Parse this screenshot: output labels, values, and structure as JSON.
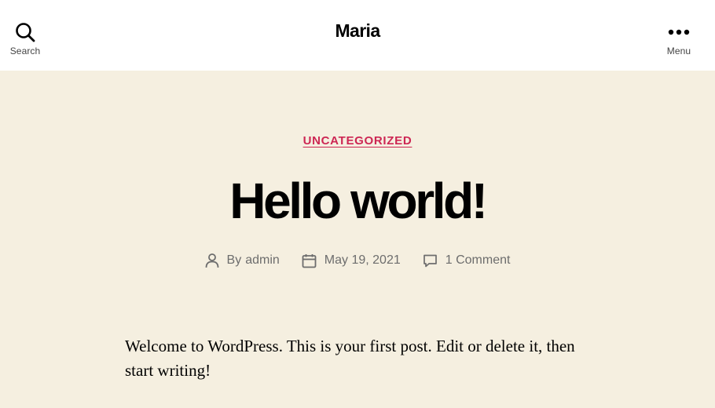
{
  "header": {
    "site_title": "Maria",
    "search_label": "Search",
    "menu_label": "Menu"
  },
  "post": {
    "category": "UNCATEGORIZED",
    "title": "Hello world!",
    "meta": {
      "author_prefix": "By",
      "author": "admin",
      "date": "May 19, 2021",
      "comments": "1 Comment"
    },
    "body": "Welcome to WordPress. This is your first post. Edit or delete it, then start writing!"
  },
  "colors": {
    "background": "#f5efe0",
    "header_background": "#ffffff",
    "accent": "#cd2653",
    "meta_text": "#6d6d6d"
  },
  "icons": {
    "search": "search-icon",
    "menu": "ellipsis-icon",
    "author": "user-icon",
    "date": "calendar-icon",
    "comments": "comment-icon"
  }
}
